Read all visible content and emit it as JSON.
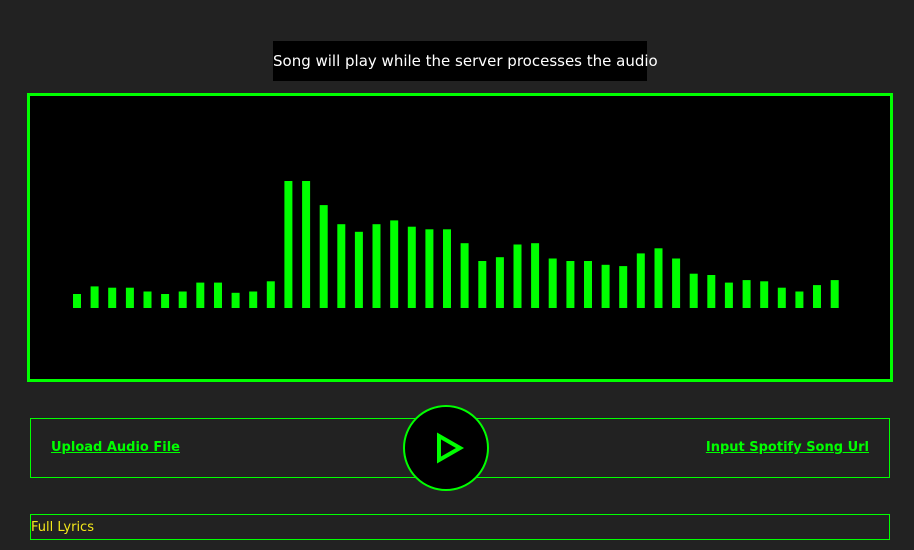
{
  "status": {
    "message": "Song will play while the server processes the audio"
  },
  "visualizer": {
    "bar_color": "#00ff00",
    "background_color": "#000000",
    "levels": [
      0.11,
      0.17,
      0.16,
      0.16,
      0.13,
      0.11,
      0.13,
      0.2,
      0.2,
      0.12,
      0.13,
      0.21,
      1.0,
      1.0,
      0.81,
      0.66,
      0.6,
      0.66,
      0.69,
      0.64,
      0.62,
      0.62,
      0.51,
      0.37,
      0.4,
      0.5,
      0.51,
      0.39,
      0.37,
      0.37,
      0.34,
      0.33,
      0.43,
      0.47,
      0.39,
      0.27,
      0.26,
      0.2,
      0.22,
      0.21,
      0.16,
      0.13,
      0.18,
      0.22
    ]
  },
  "controls": {
    "upload_label": "Upload Audio File",
    "spotify_label": "Input Spotify Song Url",
    "play_icon": "play-icon",
    "accent_color": "#00ff00"
  },
  "lyrics": {
    "title": "Full Lyrics",
    "title_color": "#f3e81a"
  }
}
